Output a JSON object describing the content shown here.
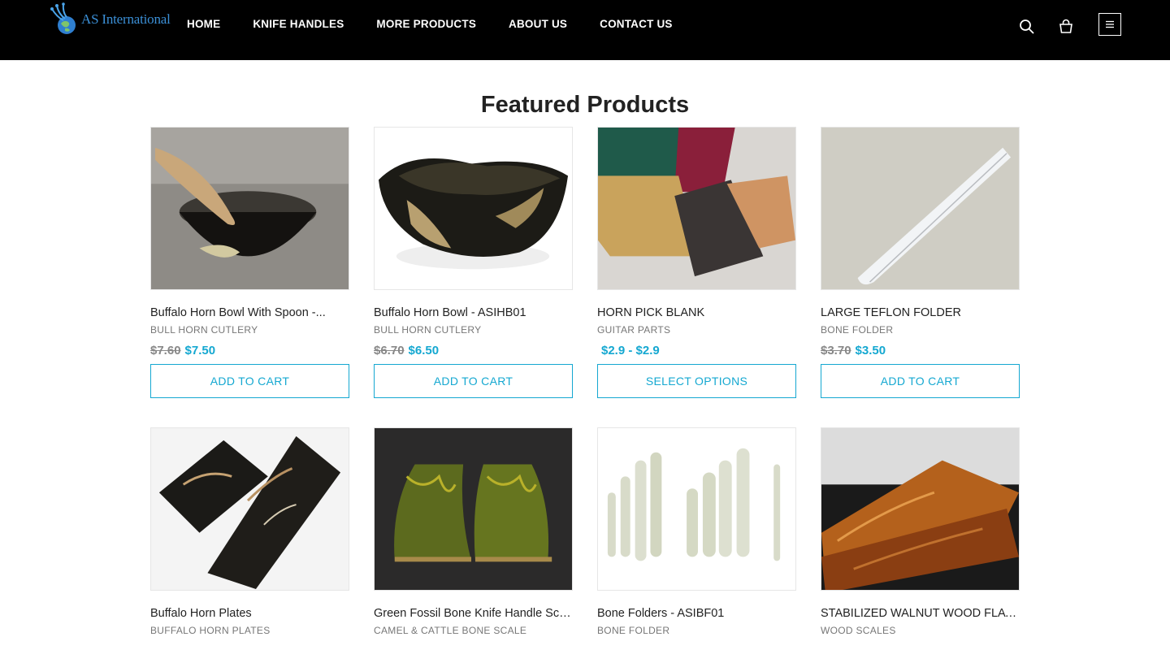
{
  "brand": {
    "name": "AS International"
  },
  "nav": [
    "HOME",
    "KNIFE HANDLES",
    "MORE PRODUCTS",
    "ABOUT US",
    "CONTACT US"
  ],
  "header_icons": [
    "search-icon",
    "shopping-bag-icon",
    "hamburger-menu-icon"
  ],
  "section": {
    "title": "Featured Products"
  },
  "colors": {
    "accent": "#15a8d1",
    "header_bg": "#000000",
    "logo_blue": "#3b8fd6"
  },
  "products": [
    {
      "name": "Buffalo Horn Bowl With Spoon -...",
      "category": "BULL HORN CUTLERY",
      "old_price": "$7.60",
      "price": "$7.50",
      "button": "ADD TO CART"
    },
    {
      "name": "Buffalo Horn Bowl - ASIHB01",
      "category": "BULL HORN CUTLERY",
      "old_price": "$6.70",
      "price": "$6.50",
      "button": "ADD TO CART"
    },
    {
      "name": "HORN PICK BLANK",
      "category": "GUITAR PARTS",
      "old_price": "",
      "price": "$2.9 - $2.9",
      "button": "SELECT OPTIONS"
    },
    {
      "name": "LARGE TEFLON FOLDER",
      "category": "BONE FOLDER",
      "old_price": "$3.70",
      "price": "$3.50",
      "button": "ADD TO CART"
    },
    {
      "name": "Buffalo Horn Plates",
      "category": "BUFFALO HORN PLATES",
      "old_price": "",
      "price": "",
      "button": ""
    },
    {
      "name": "Green Fossil Bone Knife Handle Scale",
      "category": "CAMEL & CATTLE BONE SCALE",
      "old_price": "",
      "price": "",
      "button": ""
    },
    {
      "name": "Bone Folders - ASIBF01",
      "category": "BONE FOLDER",
      "old_price": "",
      "price": "",
      "button": ""
    },
    {
      "name": "STABILIZED WALNUT WOOD FLAT...",
      "category": "WOOD SCALES",
      "old_price": "",
      "price": "",
      "button": ""
    }
  ]
}
